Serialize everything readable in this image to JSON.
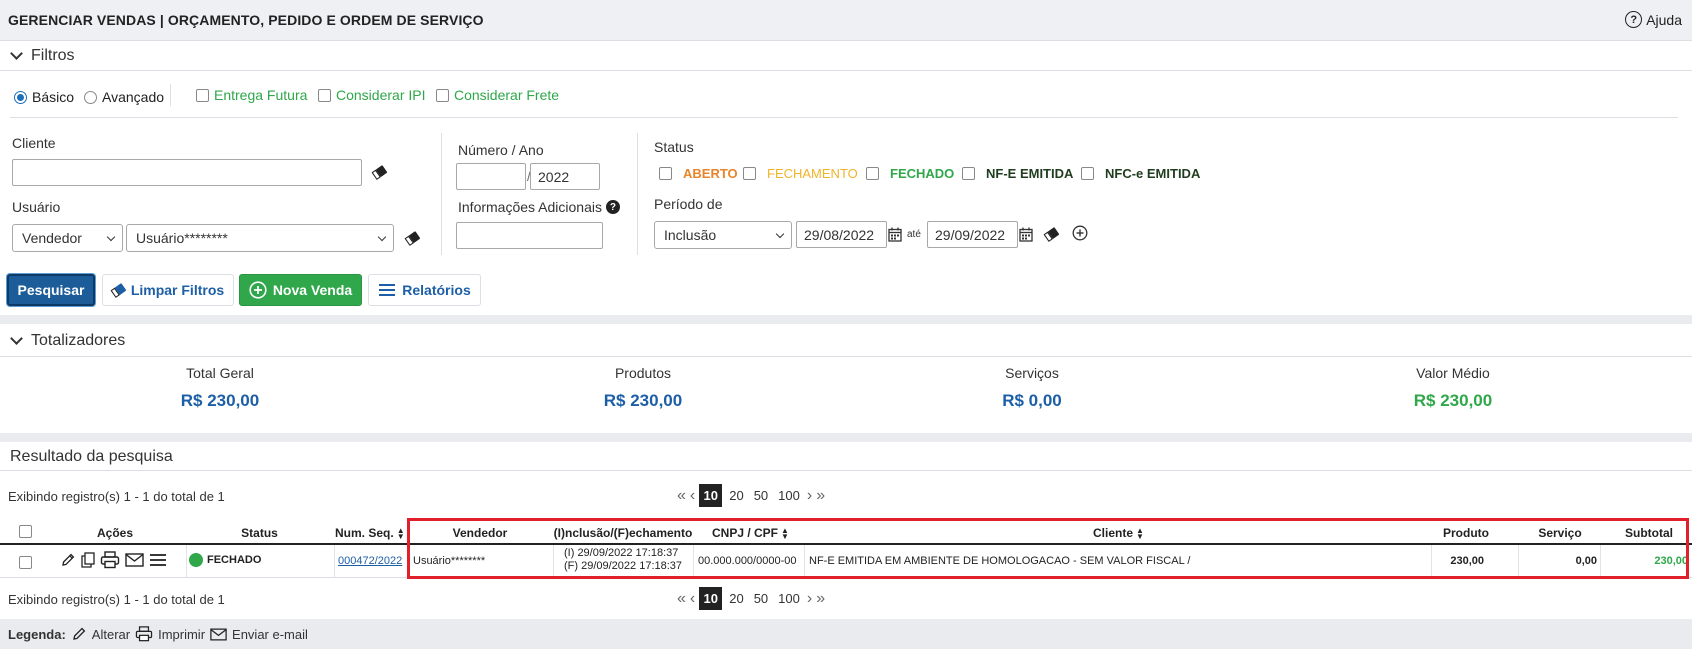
{
  "header": {
    "title": "GERENCIAR VENDAS | ORÇAMENTO, PEDIDO E ORDEM DE SERVIÇO",
    "help_label": "Ajuda"
  },
  "filters": {
    "section_title": "Filtros",
    "mode_options": [
      {
        "label": "Básico",
        "checked": true
      },
      {
        "label": "Avançado",
        "checked": false
      }
    ],
    "flags": [
      {
        "label": "Entrega Futura"
      },
      {
        "label": "Considerar IPI"
      },
      {
        "label": "Considerar Frete"
      }
    ],
    "cliente_label": "Cliente",
    "cliente_value": "",
    "usuario_label": "Usuário",
    "usuario_type": "Vendedor",
    "usuario_value": "Usuário********",
    "numero_label": "Número / Ano",
    "numero_value": "",
    "ano_value": "2022",
    "info_label": "Informações Adicionais",
    "info_value": "",
    "status_label": "Status",
    "status_options": [
      {
        "label": "ABERTO",
        "color": "#e8842a"
      },
      {
        "label": "FECHAMENTO",
        "color": "#f0b429"
      },
      {
        "label": "FECHADO",
        "color": "#2fa74a"
      },
      {
        "label": "NF-E EMITIDA",
        "color": "#1f3d1f"
      },
      {
        "label": "NFC-e EMITIDA",
        "color": "#1f3d1f"
      }
    ],
    "periodo_label": "Período de",
    "periodo_type": "Inclusão",
    "date_from": "29/08/2022",
    "ate_label": "até",
    "date_to": "29/09/2022"
  },
  "actions": {
    "pesquisar": "Pesquisar",
    "limpar": "Limpar Filtros",
    "nova_venda": "Nova Venda",
    "relatorios": "Relatórios"
  },
  "totals": {
    "section_title": "Totalizadores",
    "items": [
      {
        "label": "Total Geral",
        "value": "R$ 230,00",
        "color": "#1d5fa6"
      },
      {
        "label": "Produtos",
        "value": "R$ 230,00",
        "color": "#1d5fa6"
      },
      {
        "label": "Serviços",
        "value": "R$ 0,00",
        "color": "#1d5fa6"
      },
      {
        "label": "Valor Médio",
        "value": "R$ 230,00",
        "color": "#2fa74a"
      }
    ]
  },
  "results": {
    "section_title": "Resultado da pesquisa",
    "record_info": "Exibindo registro(s) 1 - 1 do total de 1",
    "page_sizes": [
      "10",
      "20",
      "50",
      "100"
    ],
    "active_page_size": "10",
    "columns": {
      "acoes": "Ações",
      "status": "Status",
      "num_seq": "Num. Seq.",
      "vendedor": "Vendedor",
      "inclusao": "(I)nclusão/(F)echamento",
      "cnpj": "CNPJ / CPF",
      "cliente": "Cliente",
      "produto": "Produto",
      "servico": "Serviço",
      "subtotal": "Subtotal"
    },
    "rows": [
      {
        "status": "FECHADO",
        "status_color": "#2fa74a",
        "num_seq": "000472/2022",
        "vendedor": "Usuário********",
        "inclusao": "(I) 29/09/2022 17:18:37",
        "fechamento": "(F) 29/09/2022 17:18:37",
        "cnpj": "00.000.000/0000-00",
        "cliente": "NF-E EMITIDA EM AMBIENTE DE HOMOLOGACAO - SEM VALOR FISCAL /",
        "produto": "230,00",
        "servico": "0,00",
        "subtotal": "230,00"
      }
    ]
  },
  "legend": {
    "title": "Legenda:",
    "alterar": "Alterar",
    "imprimir": "Imprimir",
    "email": "Enviar e-mail"
  },
  "colors": {
    "primary": "#1c5d99",
    "green": "#2fa74a",
    "highlight": "#e0202a"
  }
}
